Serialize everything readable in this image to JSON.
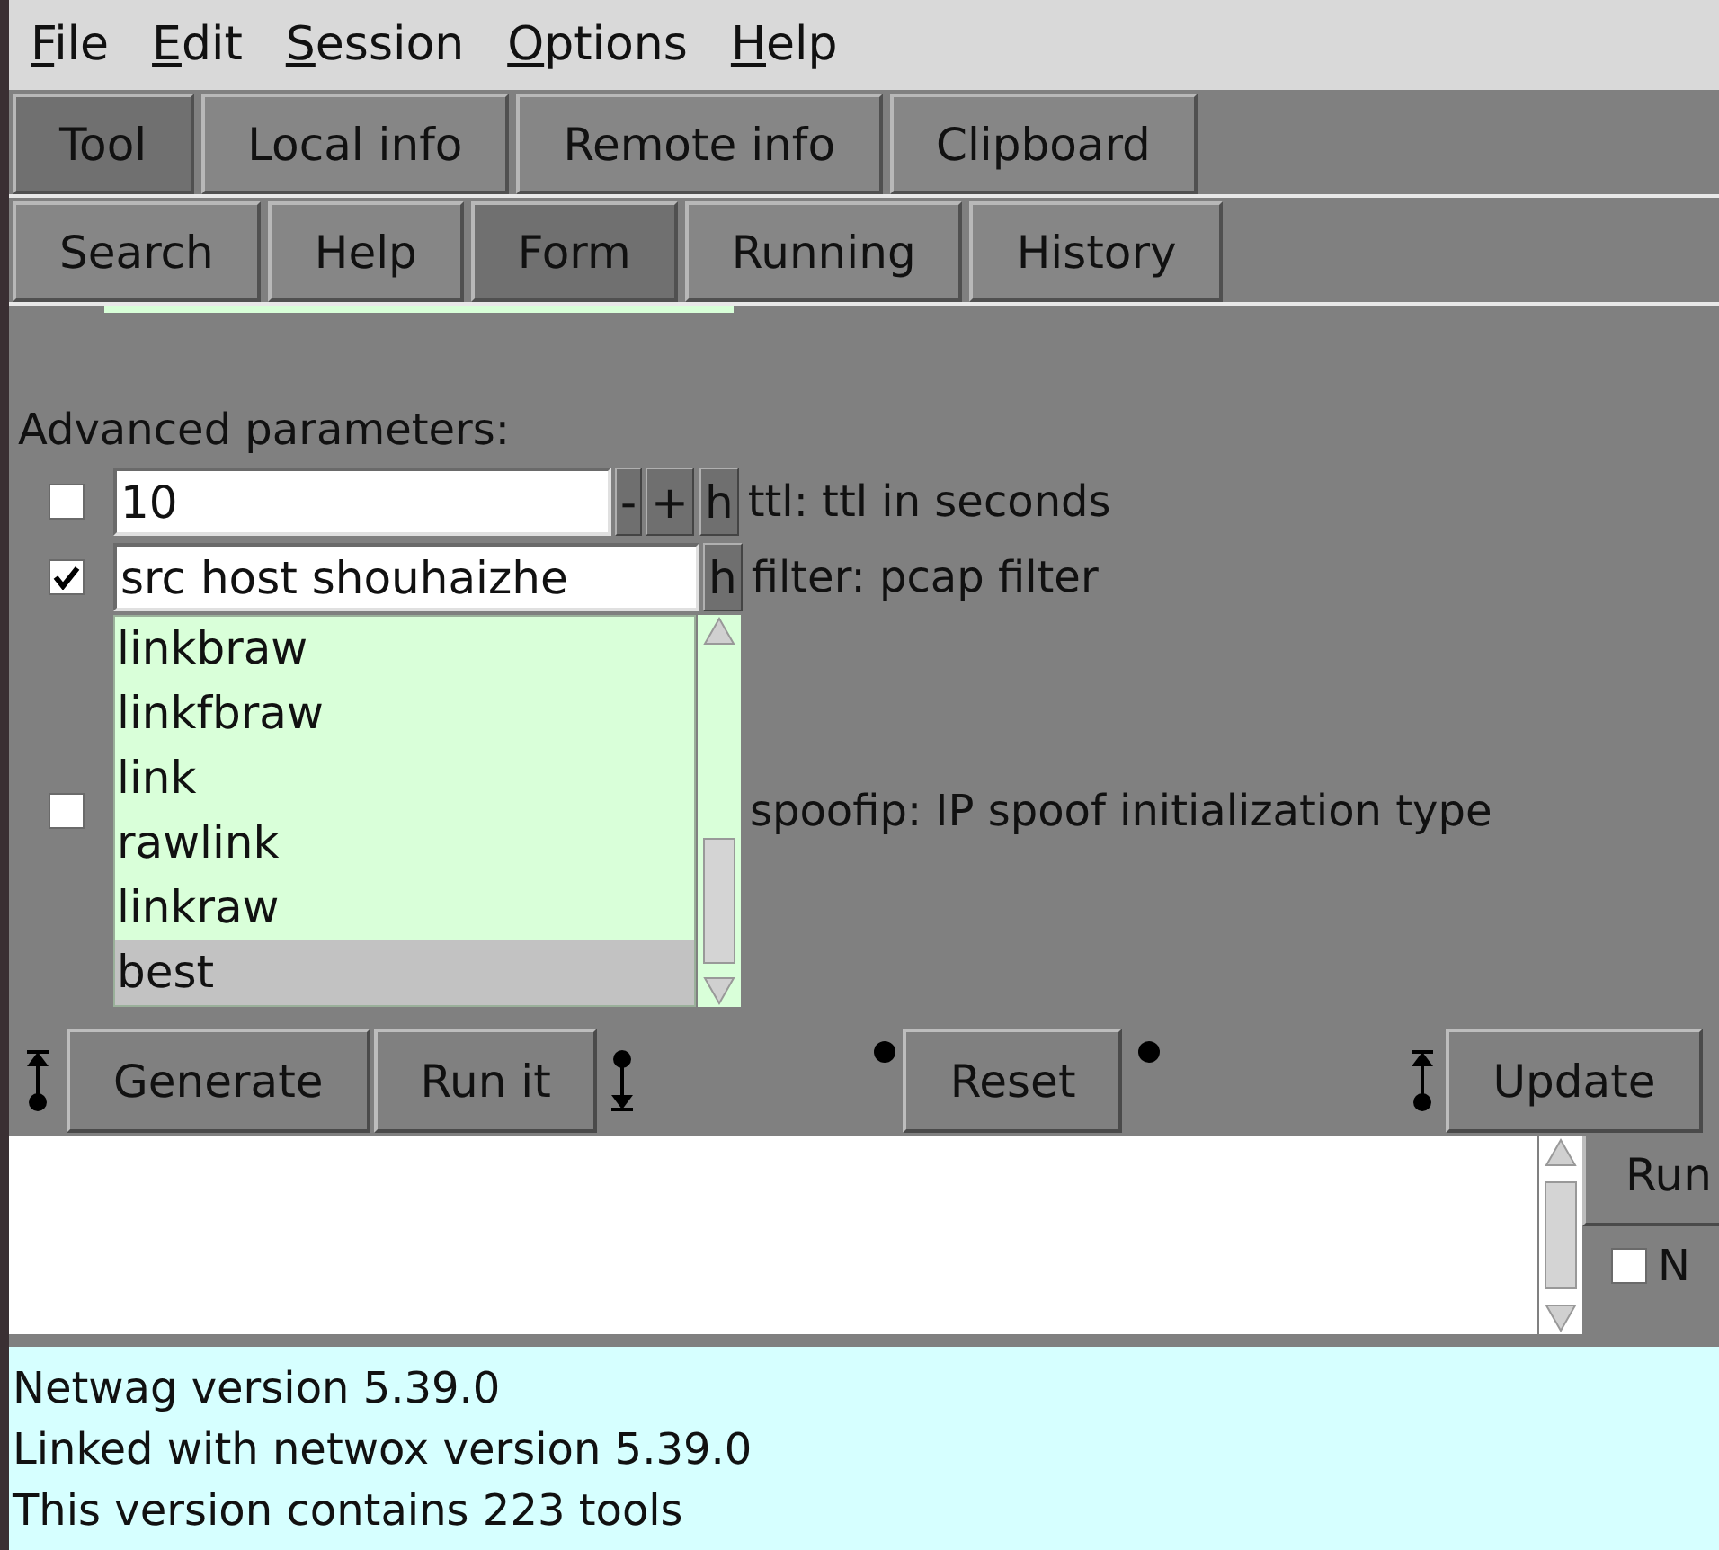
{
  "menu": [
    {
      "label": "File"
    },
    {
      "label": "Edit"
    },
    {
      "label": "Session"
    },
    {
      "label": "Options"
    },
    {
      "label": "Help"
    }
  ],
  "main_tabs": [
    {
      "label": "Tool",
      "selected": true
    },
    {
      "label": "Local info",
      "selected": false
    },
    {
      "label": "Remote info",
      "selected": false
    },
    {
      "label": "Clipboard",
      "selected": false
    }
  ],
  "tool_tabs": [
    {
      "label": "Search",
      "selected": false
    },
    {
      "label": "Help",
      "selected": false
    },
    {
      "label": "Form",
      "selected": true
    },
    {
      "label": "Running",
      "selected": false
    },
    {
      "label": "History",
      "selected": false
    }
  ],
  "advanced_parameters": {
    "title": "Advanced parameters:",
    "params": [
      {
        "kind": "spin",
        "checked": false,
        "value": "10",
        "buttons": [
          "-",
          "+"
        ],
        "help": "h",
        "label": "ttl: ttl in seconds"
      },
      {
        "kind": "text",
        "checked": true,
        "value": "src host shouhaizhe",
        "help": "h",
        "label": "filter: pcap filter"
      },
      {
        "kind": "list",
        "checked": false,
        "items": [
          {
            "label": "linkbraw",
            "selected": false
          },
          {
            "label": "linkfbraw",
            "selected": false
          },
          {
            "label": "link",
            "selected": false
          },
          {
            "label": "rawlink",
            "selected": false
          },
          {
            "label": "linkraw",
            "selected": false
          },
          {
            "label": "best",
            "selected": true
          }
        ],
        "label": "spoofip: IP spoof initialization type"
      }
    ]
  },
  "actions": [
    {
      "label": "Generate"
    },
    {
      "label": "Run it"
    },
    {
      "label": "Reset"
    },
    {
      "label": "Update"
    }
  ],
  "output": {
    "side_button": "Run",
    "side_checkbox": {
      "label": "N",
      "checked": false
    }
  },
  "status_lines": [
    "Netwag version 5.39.0",
    "Linked with netwox version 5.39.0",
    "This version contains 223 tools"
  ]
}
